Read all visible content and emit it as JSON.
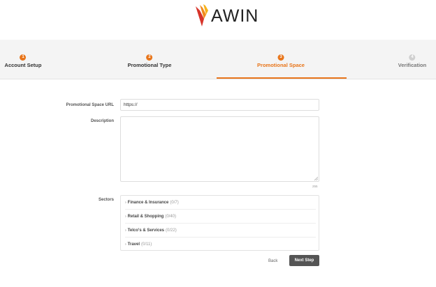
{
  "brand": {
    "name": "AWIN",
    "accent": "#e8751a"
  },
  "steps": [
    {
      "number": "1",
      "label": "Account Setup",
      "state": "done"
    },
    {
      "number": "2",
      "label": "Promotional Type",
      "state": "done"
    },
    {
      "number": "3",
      "label": "Promotional Space",
      "state": "active"
    },
    {
      "number": "4",
      "label": "Verification",
      "state": "todo"
    }
  ],
  "form": {
    "url_label": "Promotional Space URL",
    "url_value": "https://",
    "description_label": "Description",
    "description_value": "",
    "char_counter": "255",
    "sectors_label": "Sectors",
    "sectors": [
      {
        "name": "Finance & Insurance",
        "count": "(0/7)"
      },
      {
        "name": "Retail & Shopping",
        "count": "(0/40)"
      },
      {
        "name": "Telco's & Services",
        "count": "(0/22)"
      },
      {
        "name": "Travel",
        "count": "(0/11)"
      }
    ]
  },
  "actions": {
    "back_label": "Back",
    "next_label": "Next Step"
  }
}
